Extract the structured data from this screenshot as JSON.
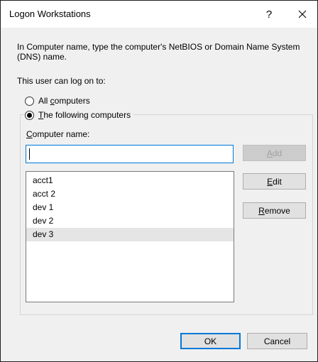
{
  "dialog": {
    "title": "Logon Workstations",
    "help_label": "?",
    "description": "In Computer name, type the computer's NetBIOS or Domain Name System (DNS) name.",
    "user_can_logon_label": "This user can log on to:"
  },
  "options": {
    "all_computers": {
      "prefix": "All ",
      "accel": "c",
      "rest": "omputers",
      "checked": false
    },
    "following_computers": {
      "prefix": "",
      "accel": "T",
      "rest": "he following computers",
      "checked": true
    }
  },
  "computer_name": {
    "label_prefix": "",
    "label_accel": "C",
    "label_rest": "omputer name:",
    "value": ""
  },
  "buttons": {
    "add": {
      "prefix": "",
      "accel": "A",
      "rest": "dd",
      "disabled": true
    },
    "edit": {
      "prefix": "",
      "accel": "E",
      "rest": "dit",
      "disabled": false
    },
    "remove": {
      "prefix": "",
      "accel": "R",
      "rest": "emove",
      "disabled": false
    },
    "ok": "OK",
    "cancel": "Cancel"
  },
  "computers": [
    "acct1",
    "acct 2",
    "dev 1",
    "dev 2",
    "dev 3"
  ],
  "selected_computer_index": 4,
  "colors": {
    "focus": "#0078d7",
    "dialog_bg": "#f0f0f0",
    "selection": "#e5e5e5"
  }
}
